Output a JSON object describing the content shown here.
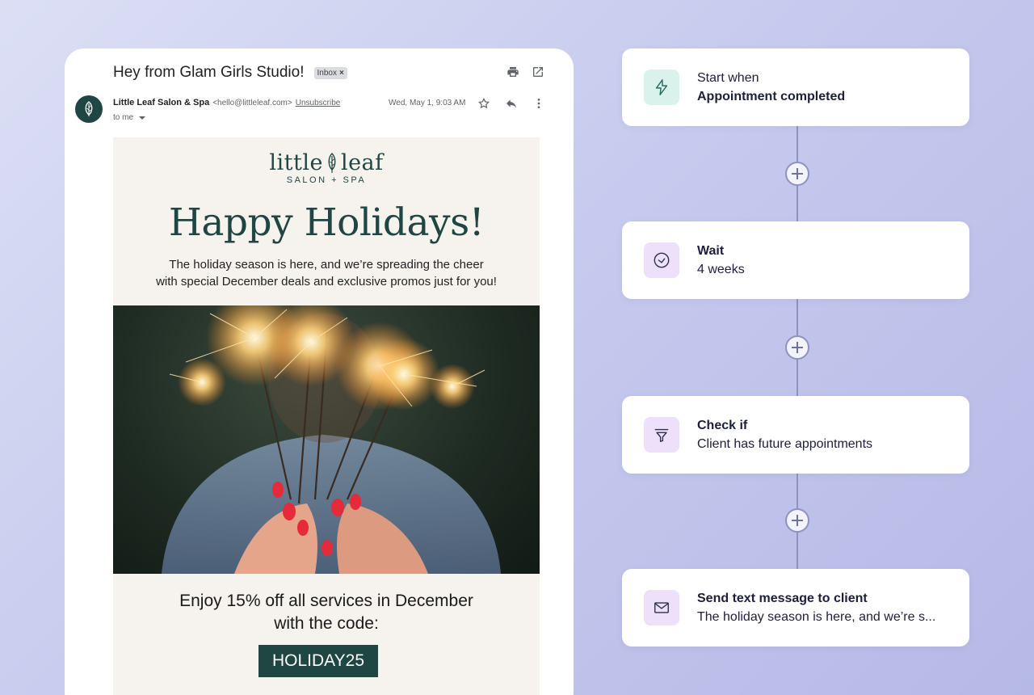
{
  "email": {
    "subject": "Hey from Glam Girls Studio!",
    "label_chip": "Inbox",
    "label_chip_close": "×",
    "sender_name": "Little Leaf Salon & Spa",
    "sender_email": "<hello@littleleaf.com>",
    "unsubscribe": "Unsubscribe",
    "recipient": "to me",
    "date": "Wed, May 1, 9:03 AM",
    "body": {
      "logo_name_part1": "little",
      "logo_name_part2": "leaf",
      "logo_sub": "SALON + SPA",
      "headline": "Happy Holidays!",
      "intro_line1": "The holiday season is here, and we’re spreading the cheer",
      "intro_line2": "with special December deals and exclusive promos just for you!",
      "offer_line1": "Enjoy 15% off all services in December",
      "offer_line2": "with the code:",
      "promo_code": "HOLIDAY25"
    }
  },
  "workflow": {
    "steps": [
      {
        "line1": "Start when",
        "line2": "Appointment completed",
        "icon": "lightning-icon",
        "icon_bg": "#d9f3ec",
        "icon_color": "#2c6b60"
      },
      {
        "line1": "Wait",
        "line2": "4 weeks",
        "icon": "clock-icon",
        "icon_bg": "#ede0fb",
        "icon_color": "#2d2f4f"
      },
      {
        "line1": "Check if",
        "line2": "Client has future appointments",
        "icon": "filter-icon",
        "icon_bg": "#ede0fb",
        "icon_color": "#2d2f4f"
      },
      {
        "line1": "Send text message to client",
        "line2": "The holiday season is here, and we’re s...",
        "icon": "envelope-icon",
        "icon_bg": "#ede0fb",
        "icon_color": "#2d2f4f"
      }
    ]
  },
  "colors": {
    "brand_green": "#1f4642",
    "flow_line": "#8e93be"
  }
}
